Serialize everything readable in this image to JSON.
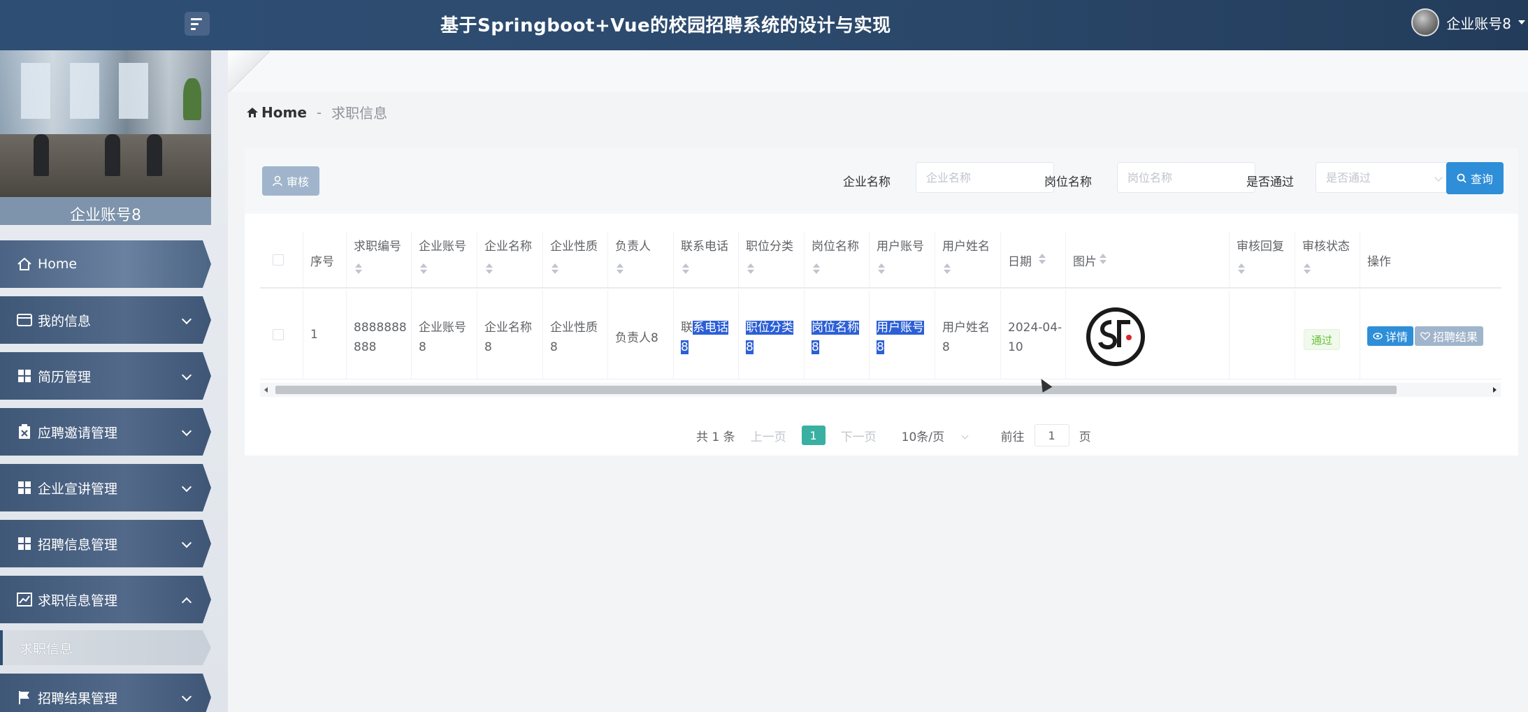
{
  "header": {
    "title": "基于Springboot+Vue的校园招聘系统的设计与实现",
    "user_name": "企业账号8"
  },
  "sidebar": {
    "profile_name": "企业账号8",
    "items": [
      {
        "label": "Home",
        "icon": "home-icon"
      },
      {
        "label": "我的信息",
        "icon": "id-card-icon"
      },
      {
        "label": "简历管理",
        "icon": "grid-icon"
      },
      {
        "label": "应聘邀请管理",
        "icon": "clipboard-x-icon"
      },
      {
        "label": "企业宣讲管理",
        "icon": "grid-icon"
      },
      {
        "label": "招聘信息管理",
        "icon": "grid-icon"
      },
      {
        "label": "求职信息管理",
        "icon": "chart-icon"
      },
      {
        "label": "招聘结果管理",
        "icon": "flag-icon"
      }
    ],
    "sub_item": "求职信息"
  },
  "breadcrumb": {
    "home": "Home",
    "separator": "-",
    "current": "求职信息"
  },
  "toolbar": {
    "audit_label": "审核",
    "company_name_label": "企业名称",
    "company_name_placeholder": "企业名称",
    "position_name_label": "岗位名称",
    "position_name_placeholder": "岗位名称",
    "passed_label": "是否通过",
    "passed_placeholder": "是否通过",
    "query_label": "查询"
  },
  "table": {
    "headers": {
      "index": "序号",
      "job_no": "求职编号",
      "company_account": "企业账号",
      "company_name": "企业名称",
      "company_type": "企业性质",
      "manager": "负责人",
      "phone": "联系电话",
      "category": "职位分类",
      "position": "岗位名称",
      "user_account": "用户账号",
      "user_name": "用户姓名",
      "date": "日期",
      "image": "图片",
      "reply": "审核回复",
      "status": "审核状态",
      "actions": "操作"
    },
    "row": {
      "index": "1",
      "job_no": "8888888888",
      "company_account": "企业账号8",
      "company_name": "企业名称8",
      "company_type": "企业性质8",
      "manager": "负责人8",
      "phone_a": "联",
      "phone_b": "系电话",
      "phone_c": "8",
      "category_a": "职位分类",
      "category_b": "8",
      "position_a": "岗位名称",
      "position_b": "8",
      "user_account_a": "用户账号",
      "user_account_b": "8",
      "user_name": "用户姓名8",
      "date": "2024-04-10",
      "reply": "",
      "status": "通过",
      "detail_label": "详情",
      "result_label": "招聘结果"
    }
  },
  "pagination": {
    "total": "共 1 条",
    "prev": "上一页",
    "current": "1",
    "next": "下一页",
    "page_size": "10条/页",
    "goto_prefix": "前往",
    "goto_value": "1",
    "goto_suffix": "页"
  },
  "colors": {
    "header_bg": "#2c4a6d",
    "primary_button": "#2e8ed8",
    "disabled_button": "#a0b5cc",
    "page_active": "#3ab0a2",
    "selection_highlight": "#2c5fd6",
    "status_success": "#67c23a"
  }
}
